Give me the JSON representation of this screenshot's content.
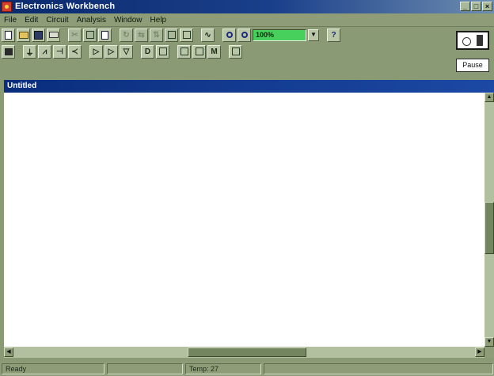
{
  "window": {
    "title": "Electronics Workbench",
    "buttons": [
      "_",
      "□",
      "×"
    ]
  },
  "menu": {
    "items": [
      "File",
      "Edit",
      "Circuit",
      "Analysis",
      "Window",
      "Help"
    ]
  },
  "toolbar": {
    "zoom_value": "100%",
    "help_label": "?"
  },
  "toolbar2": {
    "meter_label": "M"
  },
  "controls": {
    "pause_label": "Pause"
  },
  "document": {
    "title": "Untitled"
  },
  "status": {
    "ready": "Ready",
    "temp": "Temp: 27"
  },
  "colors": {
    "accent": "#0b2a6e",
    "zoom_field": "#48d05c",
    "chrome": "#8e9d78"
  }
}
